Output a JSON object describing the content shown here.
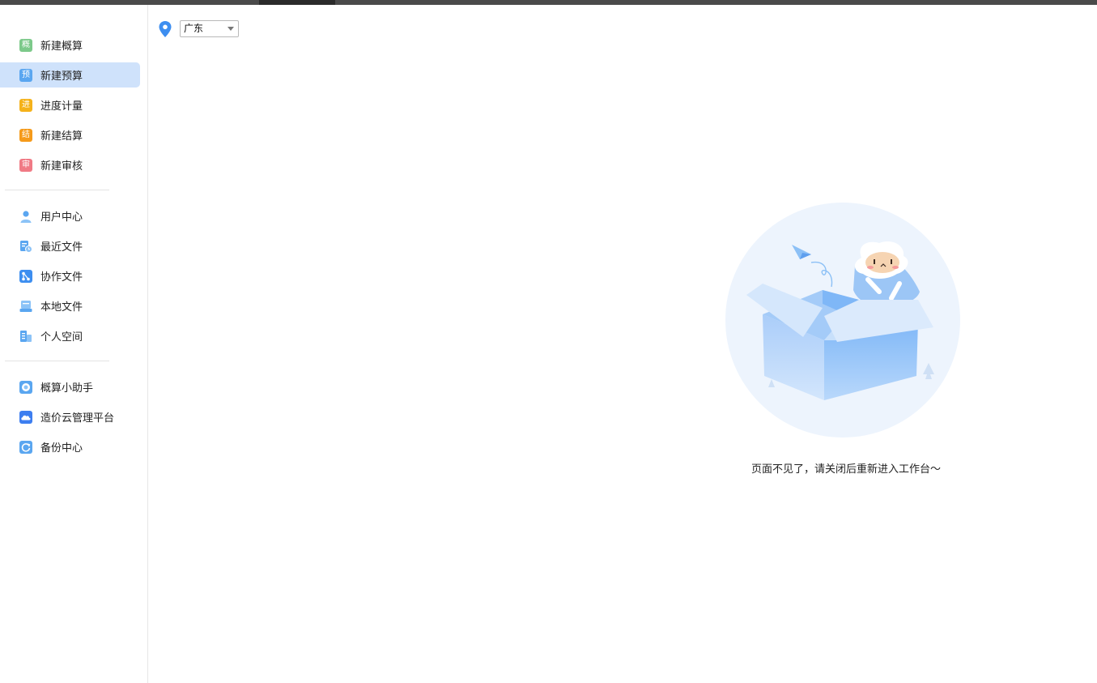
{
  "sidebar": {
    "groups": [
      {
        "items": [
          {
            "label": "新建概算",
            "icon": "gai-icon",
            "glyph": "概",
            "color": "#7cc98a",
            "active": false
          },
          {
            "label": "新建预算",
            "icon": "yu-icon",
            "glyph": "预",
            "color": "#5aa6f0",
            "active": true
          },
          {
            "label": "进度计量",
            "icon": "jin-icon",
            "glyph": "进",
            "color": "#f5b21a",
            "active": false
          },
          {
            "label": "新建结算",
            "icon": "jie-icon",
            "glyph": "结",
            "color": "#f59a1a",
            "active": false
          },
          {
            "label": "新建审核",
            "icon": "shen-icon",
            "glyph": "审",
            "color": "#f07a85",
            "active": false
          }
        ]
      },
      {
        "items": [
          {
            "label": "用户中心",
            "icon": "user-icon",
            "color": "#5aa6f0"
          },
          {
            "label": "最近文件",
            "icon": "recent-file-icon",
            "color": "#5aa6f0"
          },
          {
            "label": "协作文件",
            "icon": "collab-file-icon",
            "color": "#3d8ef0"
          },
          {
            "label": "本地文件",
            "icon": "local-file-icon",
            "color": "#5aa6f0"
          },
          {
            "label": "个人空间",
            "icon": "personal-space-icon",
            "color": "#5aa6f0"
          }
        ]
      },
      {
        "items": [
          {
            "label": "概算小助手",
            "icon": "assistant-icon",
            "color": "#5aa6f0"
          },
          {
            "label": "造价云管理平台",
            "icon": "cloud-icon",
            "color": "#3d7ef0"
          },
          {
            "label": "备份中心",
            "icon": "backup-icon",
            "color": "#5aa6f0"
          }
        ]
      }
    ]
  },
  "main": {
    "region": {
      "selected": "广东",
      "icon": "location-pin-icon",
      "color": "#3d8ef0"
    },
    "empty_state": {
      "message": "页面不见了，请关闭后重新进入工作台～",
      "illustration": "empty-box-illustration"
    }
  }
}
